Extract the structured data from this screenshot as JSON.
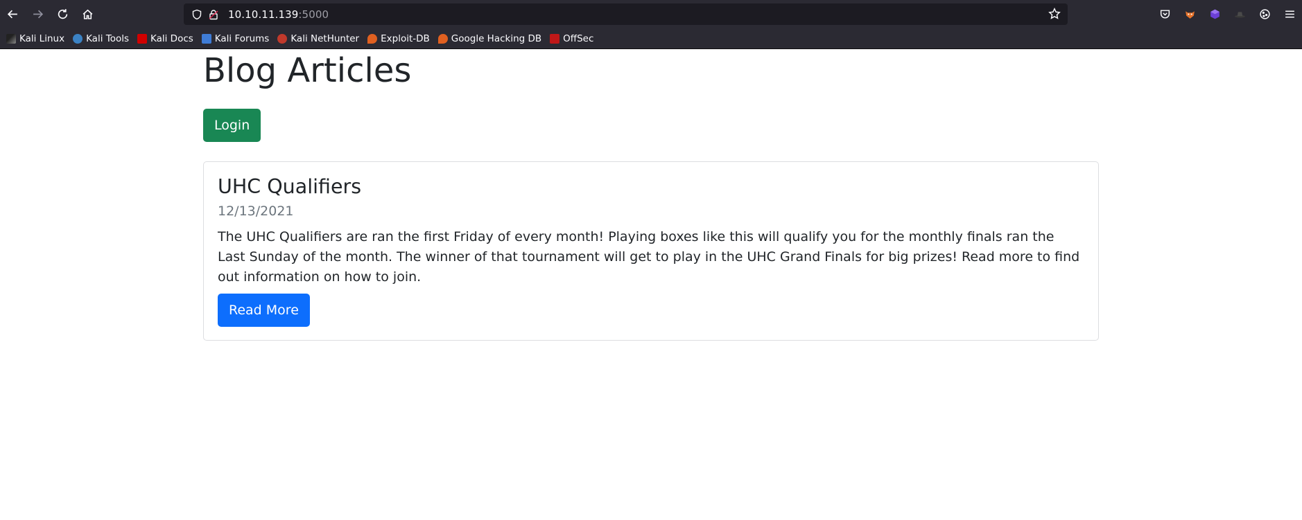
{
  "browser": {
    "url_host": "10.10.11.139",
    "url_port": ":5000",
    "bookmarks": [
      {
        "label": "Kali Linux",
        "color": "#367bf0"
      },
      {
        "label": "Kali Tools",
        "color": "#3b82c4"
      },
      {
        "label": "Kali Docs",
        "color": "#d00000"
      },
      {
        "label": "Kali Forums",
        "color": "#3f7cd6"
      },
      {
        "label": "Kali NetHunter",
        "color": "#c0392b"
      },
      {
        "label": "Exploit-DB",
        "color": "#e06020"
      },
      {
        "label": "Google Hacking DB",
        "color": "#e06020"
      },
      {
        "label": "OffSec",
        "color": "#c01818"
      }
    ]
  },
  "page": {
    "title": "Blog Articles",
    "login_label": "Login"
  },
  "articles": [
    {
      "title": "UHC Qualifiers",
      "date": "12/13/2021",
      "body": "The UHC Qualifiers are ran the first Friday of every month! Playing boxes like this will qualify you for the monthly finals ran the Last Sunday of the month. The winner of that tournament will get to play in the UHC Grand Finals for big prizes! Read more to find out information on how to join.",
      "read_more_label": "Read More"
    }
  ],
  "colors": {
    "login_button": "#198754",
    "read_more_button": "#0d6efd",
    "chrome_bg": "#2b2a33"
  }
}
